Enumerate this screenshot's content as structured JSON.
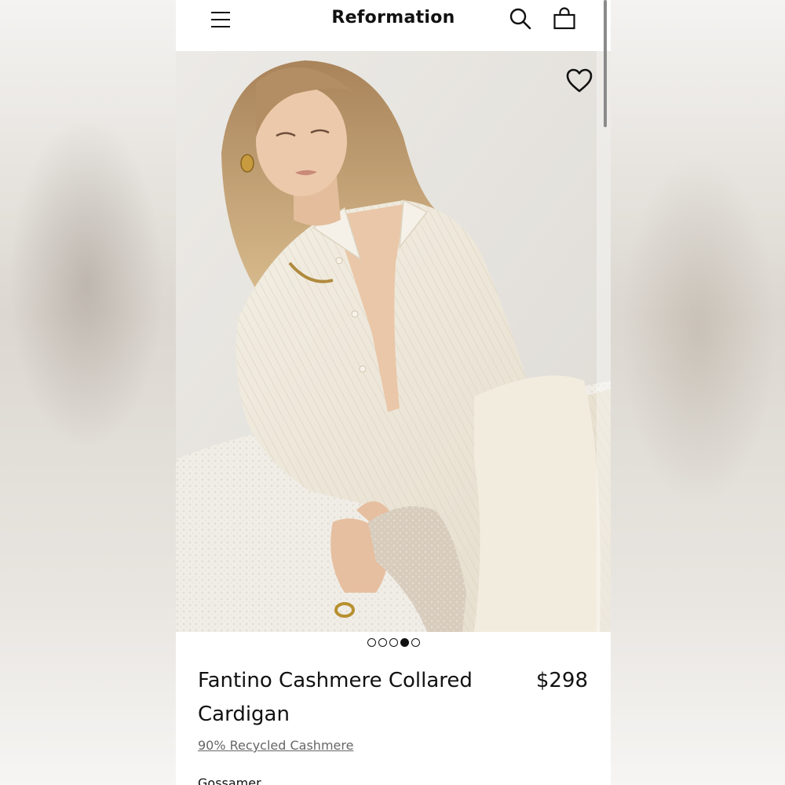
{
  "header": {
    "brand": "Reformation",
    "icons": [
      "menu-icon",
      "search-icon",
      "shopping-bag-icon"
    ]
  },
  "gallery": {
    "image_alt": "Model wearing cream ribbed collared cashmere cardigan",
    "favorite_icon": "heart-icon",
    "slide_count": 5,
    "active_slide": 4
  },
  "product": {
    "name": "Fantino Cashmere Collared Cardigan",
    "price": "$298",
    "material_link": "90% Recycled Cashmere",
    "color_label": "Gossamer"
  },
  "colors": {
    "text": "#111111",
    "link": "#666666",
    "sweater": "#efe9dc"
  }
}
